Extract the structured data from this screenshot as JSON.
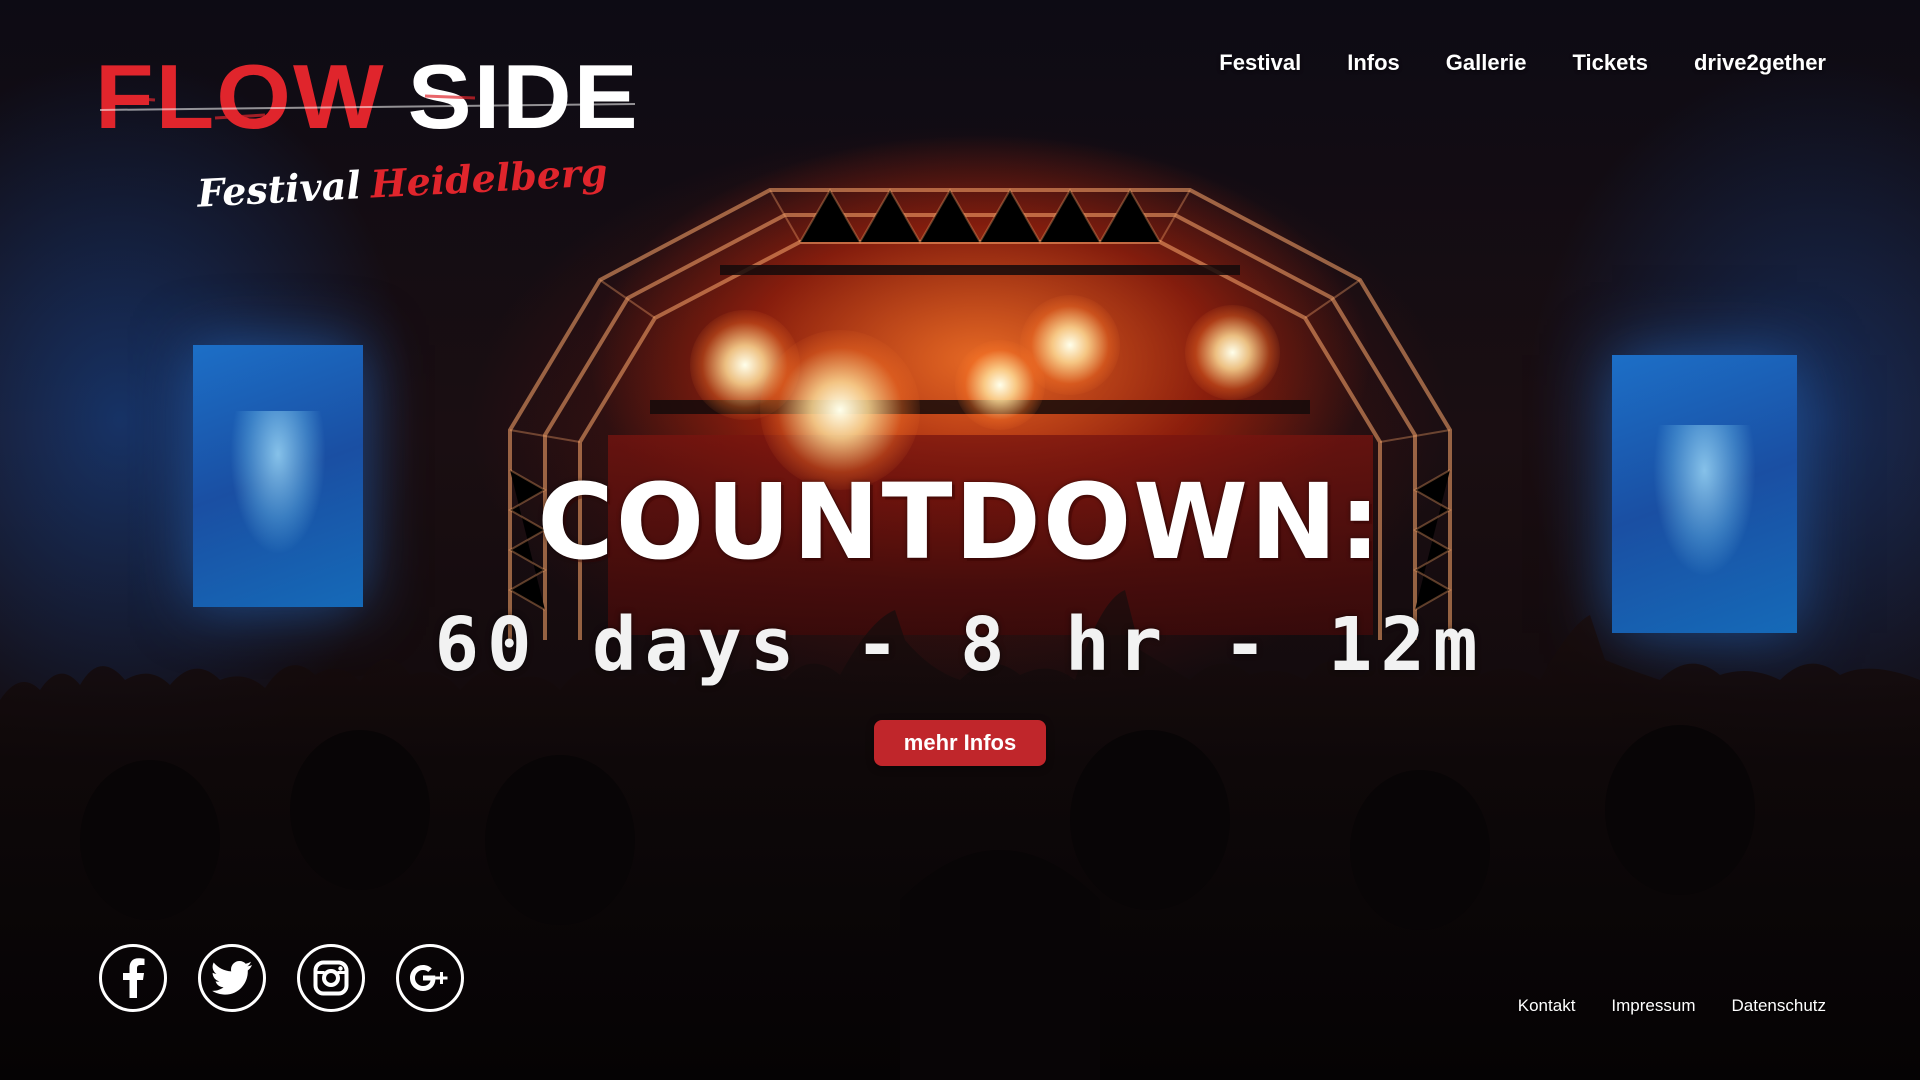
{
  "brand": {
    "name_part1": "FLOW",
    "name_part2": "SIDE",
    "tagline_part1": "Festival",
    "tagline_part2": "Heidelberg",
    "colors": {
      "red": "#e0252c",
      "white": "#ffffff",
      "button": "#c0262b"
    }
  },
  "nav": {
    "items": [
      {
        "label": "Festival"
      },
      {
        "label": "Infos"
      },
      {
        "label": "Gallerie"
      },
      {
        "label": "Tickets"
      },
      {
        "label": "drive2gether"
      }
    ]
  },
  "hero": {
    "title": "COUNTDOWN:",
    "countdown": "60 days - 8 hr - 12m",
    "cta_label": "mehr Infos"
  },
  "social": {
    "icons": [
      "facebook-icon",
      "twitter-icon",
      "instagram-icon",
      "google-plus-icon"
    ]
  },
  "footer": {
    "links": [
      {
        "label": "Kontakt"
      },
      {
        "label": "Impressum"
      },
      {
        "label": "Datenschutz"
      }
    ]
  }
}
